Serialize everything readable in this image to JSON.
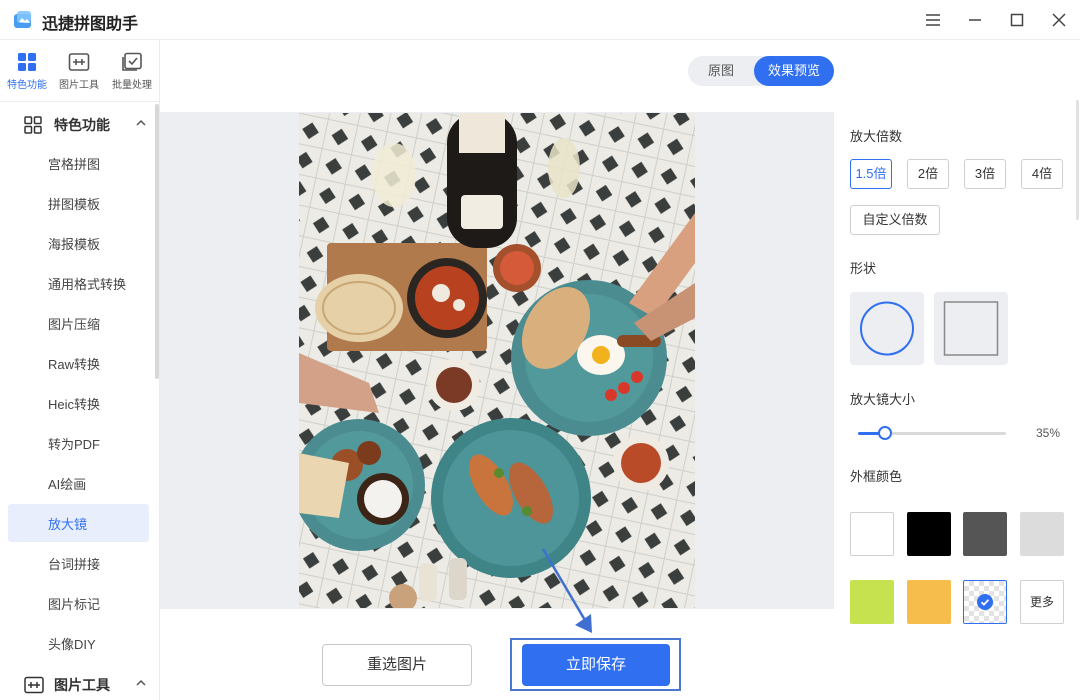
{
  "app": {
    "title": "迅捷拼图助手"
  },
  "topnav": [
    {
      "label": "特色功能",
      "icon": "grid-icon"
    },
    {
      "label": "图片工具",
      "icon": "image-tool-icon"
    },
    {
      "label": "批量处理",
      "icon": "batch-icon"
    }
  ],
  "sidebar": {
    "section_featured": "特色功能",
    "items": [
      "宫格拼图",
      "拼图模板",
      "海报模板",
      "通用格式转换",
      "图片压缩",
      "Raw转换",
      "Heic转换",
      "转为PDF",
      "AI绘画",
      "放大镜",
      "台词拼接",
      "图片标记",
      "头像DIY"
    ],
    "active_item": "放大镜",
    "section_tools": "图片工具"
  },
  "preview_toggle": {
    "original": "原图",
    "effect": "效果预览",
    "selected": "效果预览"
  },
  "actions": {
    "reselect": "重选图片",
    "save": "立即保存"
  },
  "panel": {
    "magnification_label": "放大倍数",
    "magnifications": [
      "1.5倍",
      "2倍",
      "3倍",
      "4倍"
    ],
    "selected_magnification": "1.5倍",
    "custom_label": "自定义倍数",
    "shape_label": "形状",
    "shapes": [
      "circle",
      "square"
    ],
    "selected_shape": "circle",
    "size_label": "放大镜大小",
    "size_value": "35%",
    "size_fraction": 0.35,
    "border_color_label": "外框颜色",
    "colors": [
      "#ffffff",
      "#000000",
      "#555555",
      "#dcdcdc",
      "#c6e24f",
      "#f6bc4c",
      "transparent"
    ],
    "selected_color": "transparent",
    "more_label": "更多"
  },
  "theme": {
    "accent": "#2f6ff0"
  }
}
